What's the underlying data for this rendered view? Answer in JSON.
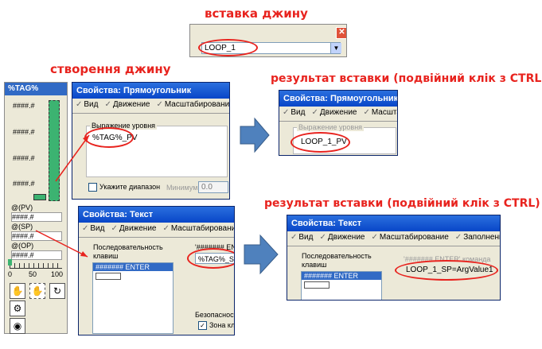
{
  "captions": {
    "insert_genie": "вставка джину",
    "create_genie": "створення джину",
    "result1": "результат вставки (подвійний клік з CTRL)",
    "result2": "результат вставки (подвійний клік з CTRL)"
  },
  "combo": {
    "value": "LOOP_1"
  },
  "tool_panel": {
    "title": "%TAG%",
    "bar_labels": [
      "####.#",
      "####.#",
      "####.#",
      "####.#"
    ],
    "pv_label": "@(PV)",
    "pv_value": "####.#",
    "sp_label": "@(SP)",
    "sp_value": "####.#",
    "op_label": "@(OP)",
    "op_value": "####.#",
    "scale": [
      "0",
      "50",
      "100"
    ]
  },
  "dialog_rect": {
    "title": "Свойства: Прямоугольник",
    "tabs": [
      "Вид",
      "Движение",
      "Масштабирование"
    ],
    "group_label": "Выражение уровня",
    "expression": "%TAG%_PV",
    "range_checkbox": "Укажите диапазон",
    "min_label": "Минимум:",
    "min_value": "0.0"
  },
  "dialog_text": {
    "title": "Свойства: Текст",
    "tabs": [
      "Вид",
      "Движение",
      "Масштабирование"
    ],
    "seq_label": "Последовательность клавиш",
    "seq_item": "####### ENTER",
    "cmd_label": "'####### EN",
    "cmd_value": "%TAG%_SP=",
    "security_label": "Безопасность",
    "zone_label": "Зона клас"
  },
  "result_rect": {
    "title": "Свойства: Прямоугольник",
    "tabs": [
      "Вид",
      "Движение",
      "Масшта"
    ],
    "group_label": "Выражение уровня",
    "expression": "LOOP_1_PV"
  },
  "result_text": {
    "title": "Свойства: Текст",
    "tabs": [
      "Вид",
      "Движение",
      "Масштабирование",
      "Заполнение"
    ],
    "seq_label": "Последовательность клавиш",
    "seq_item": "####### ENTER",
    "cmd_label": "'####### ENTER' команда",
    "cmd_value": "LOOP_1_SP=ArgValue1"
  },
  "colors": {
    "caption": "#e8231e",
    "arrow": "#4f81bd",
    "bar": "#3cb371",
    "titlebar": "#0846c8"
  }
}
